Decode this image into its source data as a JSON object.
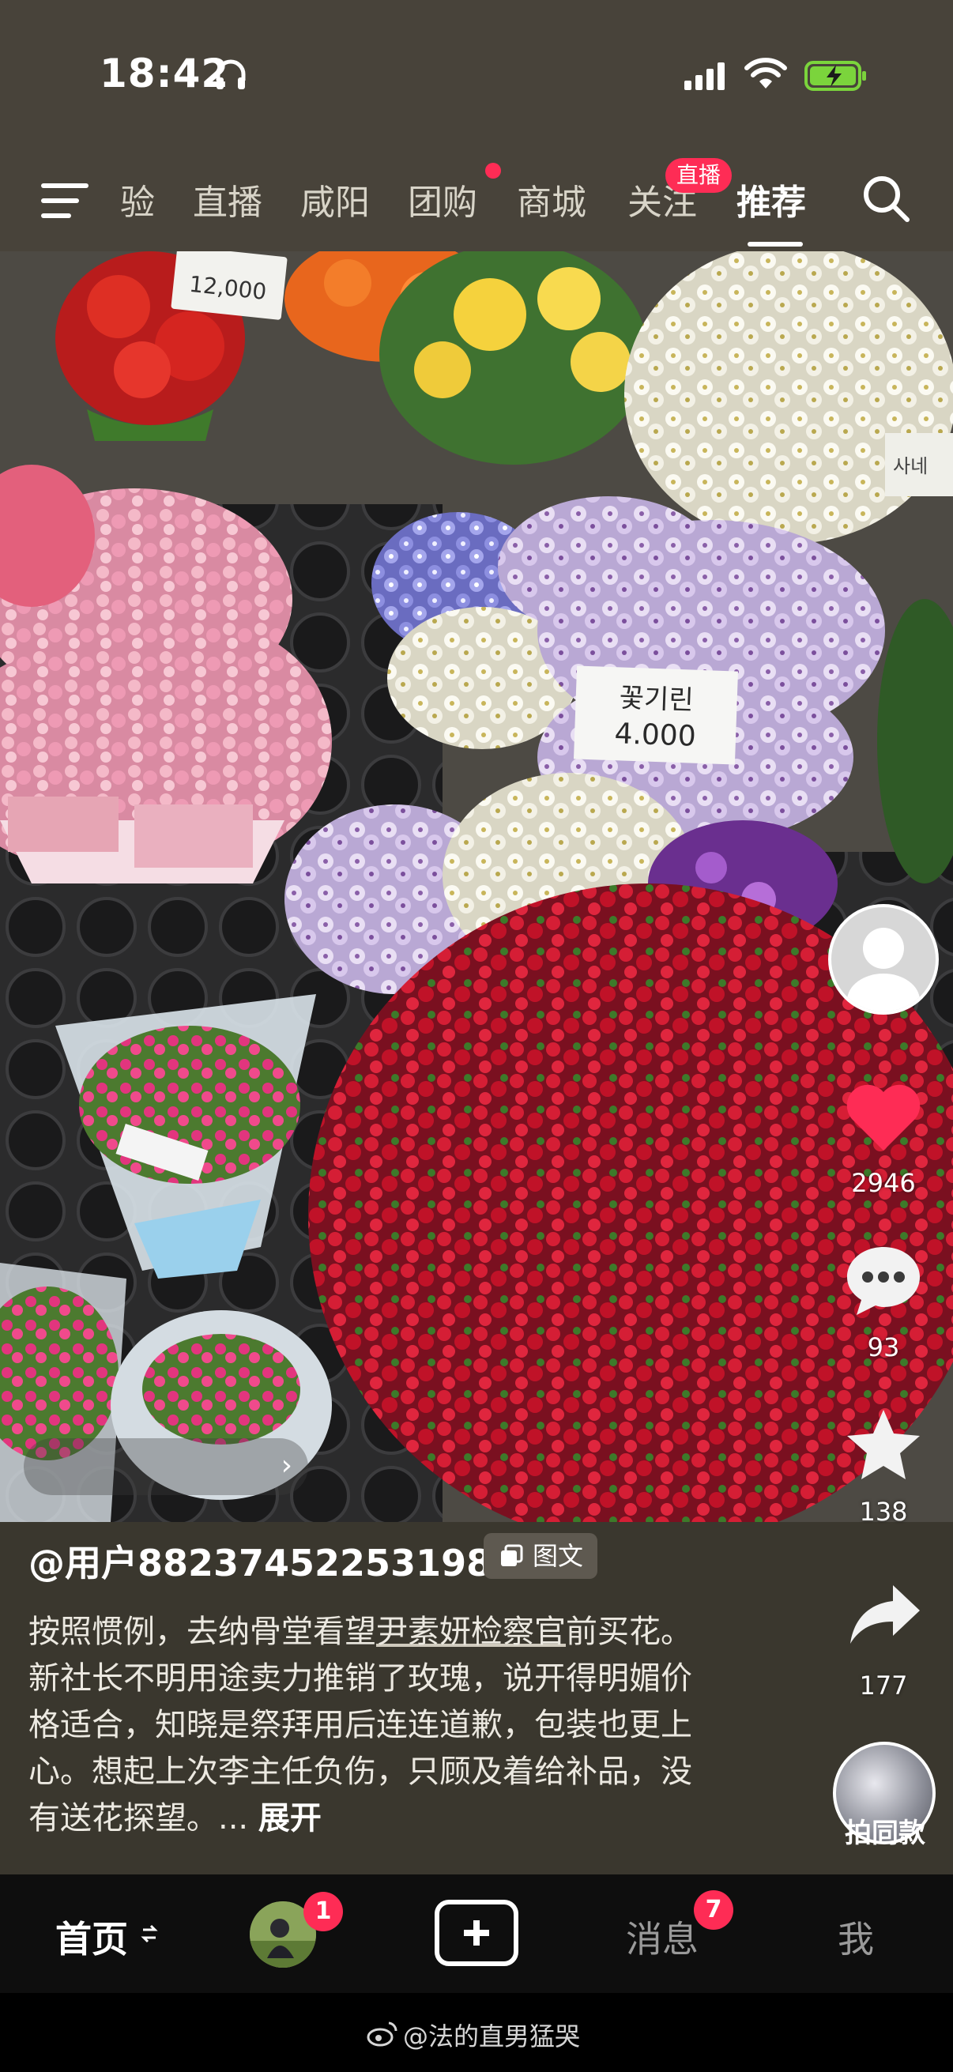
{
  "status_bar": {
    "time": "18:42",
    "icons": [
      "headphones-icon",
      "cellular-signal-icon",
      "wifi-icon",
      "battery-charging-icon"
    ]
  },
  "top_nav": {
    "tabs": [
      "验",
      "直播",
      "咸阳",
      "团购",
      "商城",
      "关注",
      "推荐"
    ],
    "active_tab": "推荐",
    "live_badge": "直播",
    "icons": [
      "menu-icon",
      "search-icon"
    ]
  },
  "photo": {
    "price_tags": {
      "top": "12,000",
      "center_title": "꽃기린",
      "center_price": "4.000",
      "right": "사네"
    }
  },
  "actions": {
    "like_count": "2946",
    "comment_count": "93",
    "favorite_count": "138",
    "share_count": "177",
    "remix_label": "拍同款"
  },
  "post": {
    "author": "@用户88237452253198",
    "type_tag": "图文",
    "caption_before": "按照惯例，去纳骨堂看望",
    "caption_link": "尹素妍检察官",
    "caption_after": "前买花。新社长不明用途卖力推销了玫瑰，说开得明媚价格适合，知晓是祭拜用后连连道歉，包装也更上心。想起上次李主任负伤，只顾及着给补品，没有送花探望。...",
    "expand": "展开"
  },
  "tab_bar": {
    "home": "首页",
    "friend_badge": "1",
    "messages": "消息",
    "messages_badge": "7",
    "me": "我"
  },
  "watermark": "@法的直男猛哭",
  "colors": {
    "accent_red": "#fe2c55",
    "nav_bg": "#48433a",
    "tabbar_bg": "#0e0e0e"
  }
}
